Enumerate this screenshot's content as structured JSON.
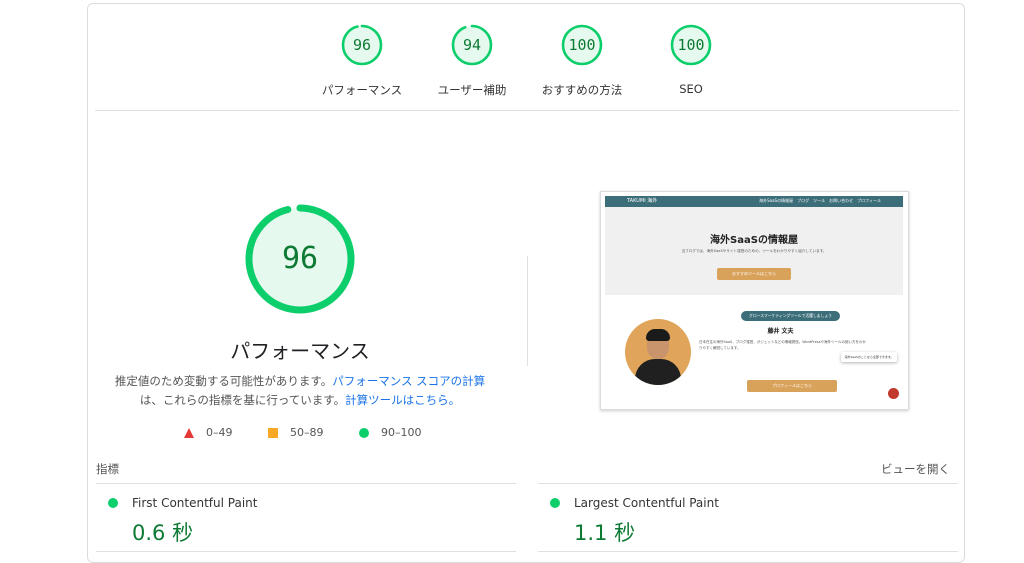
{
  "top_scores": [
    {
      "score": "96",
      "label": "パフォーマンス",
      "fraction": 0.96
    },
    {
      "score": "94",
      "label": "ユーザー補助",
      "fraction": 0.94
    },
    {
      "score": "100",
      "label": "おすすめの方法",
      "fraction": 1.0
    },
    {
      "score": "100",
      "label": "SEO",
      "fraction": 1.0
    }
  ],
  "main": {
    "score": "96",
    "fraction": 0.96,
    "title": "パフォーマンス",
    "desc_1": "推定値のため変動する可能性があります。",
    "desc_link_1": "パフォーマンス スコアの計算",
    "desc_2": "は、これらの指標を基に行っています。",
    "desc_link_2": "計算ツールはこちら。"
  },
  "legend": {
    "fail": "0–49",
    "average": "50–89",
    "pass": "90–100"
  },
  "screenshot": {
    "logo": "TAKUMI 海外",
    "nav": "海外SaaSの情報屋　ブログ　ツール　お問い合わせ　プロフィール",
    "hero_title": "海外SaaSの情報屋",
    "hero_sub": "当ブログでは、海外SaaSやサイト運営のための、ツールをわかりやすく紹介しています。",
    "hero_button": "おすすめツールはこちら",
    "pill": "グロースマーケティングツールで活躍しましょう",
    "author": "藤井 文夫",
    "bio": "日本在住の海外SaaS、ブログ運営、ガジェットなどの情報発信。WordPressや海外ツールの使い方をわかりやすく解説しています。",
    "bubble": "海外SaaSのことなら全部できます。",
    "profile_button": "プロフィールはこちら"
  },
  "metrics": {
    "header": "指標",
    "expand": "ビューを開く",
    "items": [
      {
        "name": "First Contentful Paint",
        "value": "0.6 秒"
      },
      {
        "name": "Largest Contentful Paint",
        "value": "1.1 秒"
      }
    ]
  },
  "colors": {
    "pass": "#0cce6b",
    "pass_text": "#0d7a34",
    "average": "#f9a825",
    "fail": "#e53935",
    "link": "#1a73e8"
  }
}
